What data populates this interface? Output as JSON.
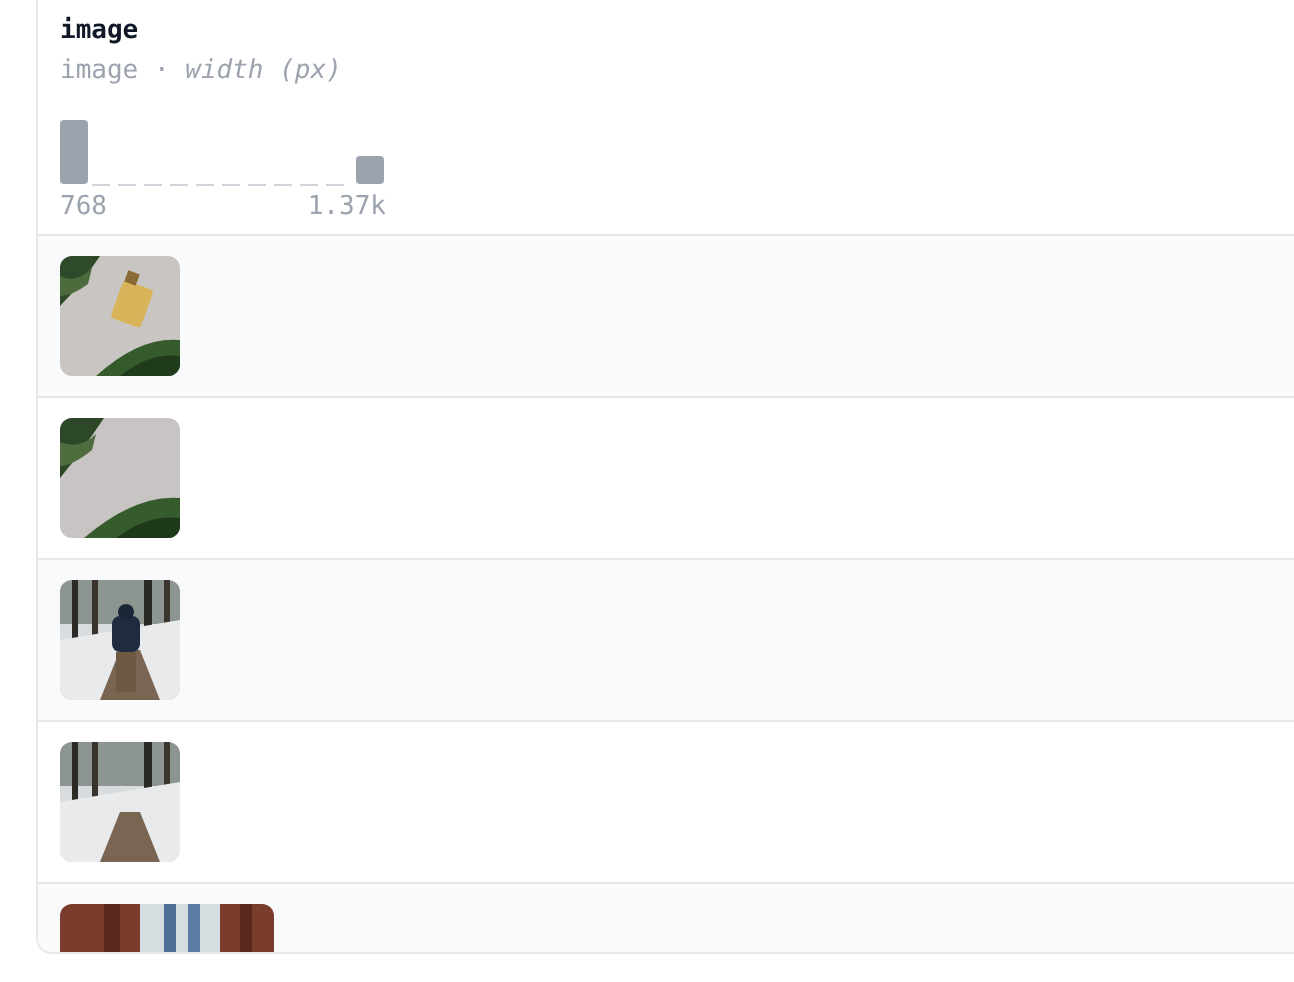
{
  "column": {
    "name": "image",
    "type": "image · *width (px)*",
    "min_label": "768",
    "max_label": "1.37k"
  }
}
